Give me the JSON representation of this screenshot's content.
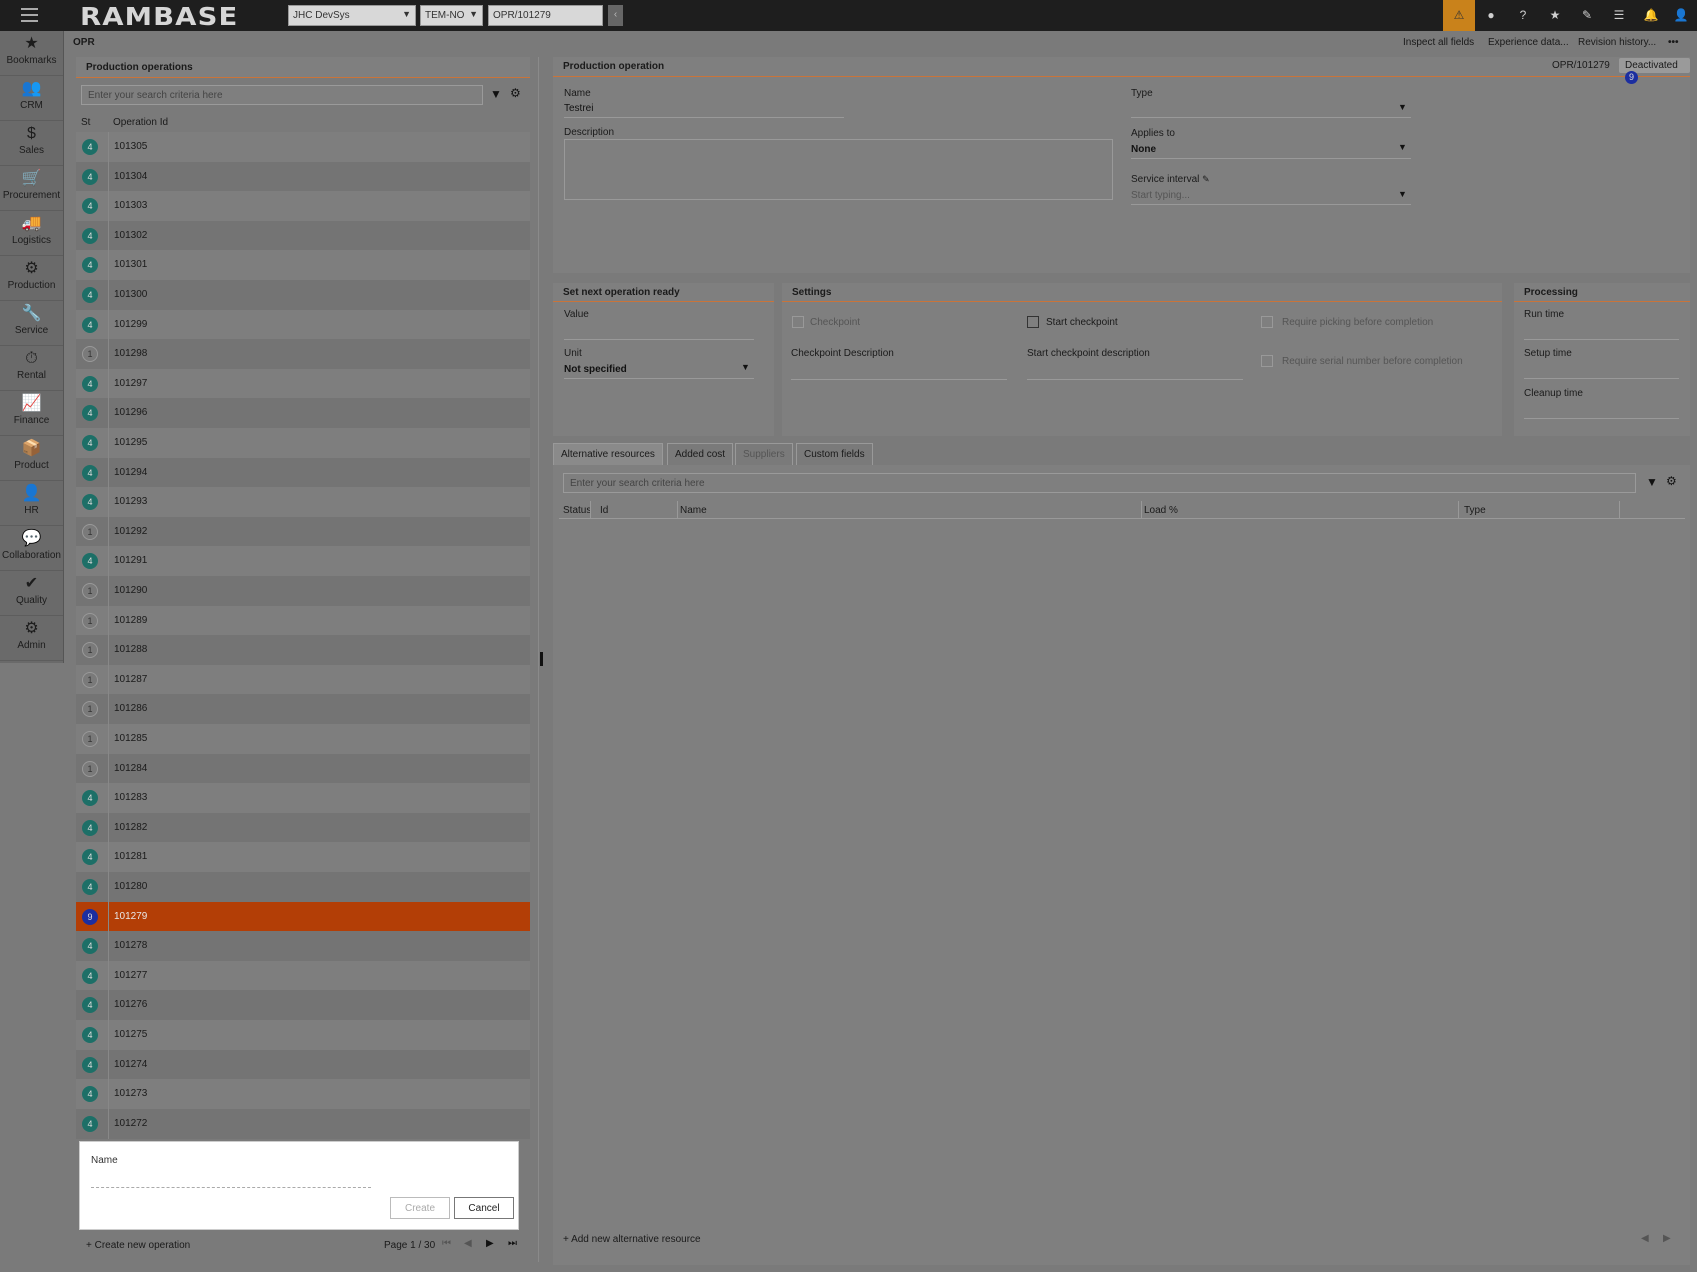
{
  "topbar": {
    "logo": "RAMBASE",
    "company": "JHC DevSys",
    "database": "TEM-NO",
    "object_ref": "OPR/101279",
    "back_label": "‹",
    "icons": [
      "warning-icon",
      "help-circle-icon",
      "question-icon",
      "star-icon",
      "paperclip-icon",
      "list-icon",
      "bell-icon",
      "user-icon"
    ],
    "icon_glyphs": [
      "⚠",
      "●",
      "?",
      "★",
      "✎",
      "☰",
      "🔔",
      "👤"
    ]
  },
  "nav": [
    {
      "label": "Bookmarks",
      "icon": "★"
    },
    {
      "label": "CRM",
      "icon": "👥"
    },
    {
      "label": "Sales",
      "icon": "$"
    },
    {
      "label": "Procurement",
      "icon": "🛒"
    },
    {
      "label": "Logistics",
      "icon": "🚚"
    },
    {
      "label": "Production",
      "icon": "⚙"
    },
    {
      "label": "Service",
      "icon": "🔧"
    },
    {
      "label": "Rental",
      "icon": "⏱"
    },
    {
      "label": "Finance",
      "icon": "📈"
    },
    {
      "label": "Product",
      "icon": "📦"
    },
    {
      "label": "HR",
      "icon": "👤"
    },
    {
      "label": "Collaboration",
      "icon": "💬"
    },
    {
      "label": "Quality",
      "icon": "✔"
    },
    {
      "label": "Admin",
      "icon": "⚙"
    }
  ],
  "header": {
    "crumb": "OPR",
    "inspect": "Inspect all fields",
    "experience": "Experience data...",
    "revision": "Revision history...",
    "more": "•••"
  },
  "list": {
    "title": "Production operations",
    "search_placeholder": "Enter your search criteria here",
    "col_st": "St",
    "col_id": "Operation Id",
    "rows": [
      {
        "st": "4",
        "id": "101305"
      },
      {
        "st": "4",
        "id": "101304"
      },
      {
        "st": "4",
        "id": "101303"
      },
      {
        "st": "4",
        "id": "101302"
      },
      {
        "st": "4",
        "id": "101301"
      },
      {
        "st": "4",
        "id": "101300"
      },
      {
        "st": "4",
        "id": "101299"
      },
      {
        "st": "1",
        "id": "101298"
      },
      {
        "st": "4",
        "id": "101297"
      },
      {
        "st": "4",
        "id": "101296"
      },
      {
        "st": "4",
        "id": "101295"
      },
      {
        "st": "4",
        "id": "101294"
      },
      {
        "st": "4",
        "id": "101293"
      },
      {
        "st": "1",
        "id": "101292"
      },
      {
        "st": "4",
        "id": "101291"
      },
      {
        "st": "1",
        "id": "101290"
      },
      {
        "st": "1",
        "id": "101289"
      },
      {
        "st": "1",
        "id": "101288"
      },
      {
        "st": "1",
        "id": "101287"
      },
      {
        "st": "1",
        "id": "101286"
      },
      {
        "st": "1",
        "id": "101285"
      },
      {
        "st": "1",
        "id": "101284"
      },
      {
        "st": "4",
        "id": "101283"
      },
      {
        "st": "4",
        "id": "101282"
      },
      {
        "st": "4",
        "id": "101281"
      },
      {
        "st": "4",
        "id": "101280"
      },
      {
        "st": "9",
        "id": "101279",
        "selected": true
      },
      {
        "st": "4",
        "id": "101278"
      },
      {
        "st": "4",
        "id": "101277"
      },
      {
        "st": "4",
        "id": "101276"
      },
      {
        "st": "4",
        "id": "101275"
      },
      {
        "st": "4",
        "id": "101274"
      },
      {
        "st": "4",
        "id": "101273"
      },
      {
        "st": "4",
        "id": "101272"
      }
    ],
    "create_label": "Create new operation",
    "page_info": "Page 1 / 30"
  },
  "dialog": {
    "name_label": "Name",
    "create": "Create",
    "cancel": "Cancel"
  },
  "detail": {
    "title": "Production operation",
    "ref": "OPR/101279",
    "status": "Deactivated",
    "status_num": "9",
    "name_label": "Name",
    "name_value": "Testrei",
    "description_label": "Description",
    "type_label": "Type",
    "applies_label": "Applies to",
    "applies_value": "None",
    "service_interval_label": "Service interval",
    "service_interval_placeholder": "Start typing..."
  },
  "next_op": {
    "title": "Set next operation ready",
    "value_label": "Value",
    "unit_label": "Unit",
    "unit_value": "Not specified"
  },
  "settings": {
    "title": "Settings",
    "checkpoint": "Checkpoint",
    "start_checkpoint": "Start checkpoint",
    "require_picking": "Require picking before completion",
    "checkpoint_desc": "Checkpoint Description",
    "start_checkpoint_desc": "Start checkpoint description",
    "require_serial": "Require serial number before completion"
  },
  "processing": {
    "title": "Processing",
    "run": "Run time",
    "setup": "Setup time",
    "cleanup": "Cleanup time"
  },
  "tabs": [
    "Alternative resources",
    "Added cost",
    "Suppliers",
    "Custom fields"
  ],
  "resources": {
    "search_placeholder": "Enter your search criteria here",
    "cols": [
      "Status",
      "Id",
      "Name",
      "Load %",
      "Type"
    ],
    "add_label": "Add new alternative resource"
  }
}
